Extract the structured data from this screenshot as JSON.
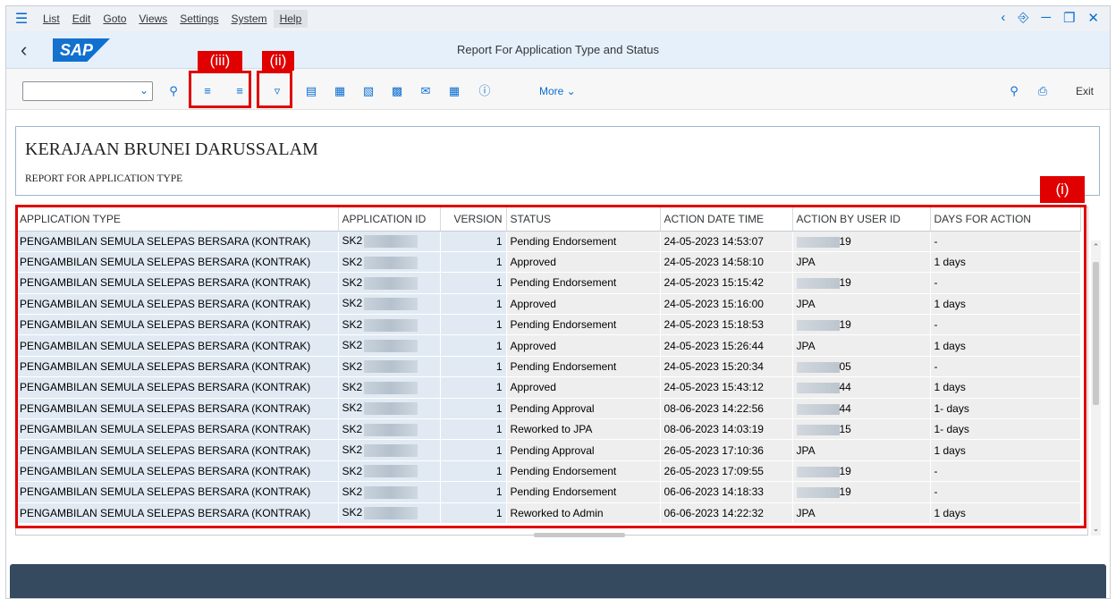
{
  "menu": {
    "items": [
      "List",
      "Edit",
      "Goto",
      "Views",
      "Settings",
      "System",
      "Help"
    ]
  },
  "window_controls": [
    "‹",
    "⎋",
    "—",
    "❐",
    "✕"
  ],
  "titlebar": {
    "logo": "SAP",
    "title": "Report For Application Type and Status"
  },
  "toolbar": {
    "combo_value": "",
    "more_label": "More",
    "exit_label": "Exit",
    "icons": [
      "dropdown-icon",
      "search-icon",
      "sort-ascending-icon",
      "sort-descending-icon",
      "filter-icon",
      "print-preview-icon",
      "excel-export-icon",
      "word-export-icon",
      "local-file-icon",
      "mail-icon",
      "grid-layout-icon",
      "info-icon",
      "find-icon",
      "print-icon"
    ]
  },
  "annotations": {
    "i": "(i)",
    "ii": "(ii)",
    "iii": "(iii)",
    "colors": {
      "box": "#e00000"
    }
  },
  "report": {
    "title": "KERAJAAN BRUNEI DARUSSALAM",
    "subtitle": "REPORT FOR APPLICATION TYPE"
  },
  "grid": {
    "columns": [
      "APPLICATION TYPE",
      "APPLICATION ID",
      "VERSION",
      "STATUS",
      "ACTION DATE TIME",
      "ACTION BY USER ID",
      "DAYS FOR ACTION"
    ],
    "rows": [
      [
        "PENGAMBILAN SEMULA SELEPAS BERSARA (KONTRAK)",
        "SK2",
        "1",
        "Pending Endorsement",
        "24-05-2023 14:53:07",
        "19",
        "-"
      ],
      [
        "PENGAMBILAN SEMULA SELEPAS BERSARA (KONTRAK)",
        "SK2",
        "1",
        "Approved",
        "24-05-2023 14:58:10",
        "JPA",
        "1 days"
      ],
      [
        "PENGAMBILAN SEMULA SELEPAS BERSARA (KONTRAK)",
        "SK2",
        "1",
        "Pending Endorsement",
        "24-05-2023 15:15:42",
        "19",
        "-"
      ],
      [
        "PENGAMBILAN SEMULA SELEPAS BERSARA (KONTRAK)",
        "SK2",
        "1",
        "Approved",
        "24-05-2023 15:16:00",
        "JPA",
        "1 days"
      ],
      [
        "PENGAMBILAN SEMULA SELEPAS BERSARA (KONTRAK)",
        "SK2",
        "1",
        "Pending Endorsement",
        "24-05-2023 15:18:53",
        "19",
        "-"
      ],
      [
        "PENGAMBILAN SEMULA SELEPAS BERSARA (KONTRAK)",
        "SK2",
        "1",
        "Approved",
        "24-05-2023 15:26:44",
        "JPA",
        "1 days"
      ],
      [
        "PENGAMBILAN SEMULA SELEPAS BERSARA (KONTRAK)",
        "SK2",
        "1",
        "Pending Endorsement",
        "24-05-2023 15:20:34",
        "05",
        "-"
      ],
      [
        "PENGAMBILAN SEMULA SELEPAS BERSARA (KONTRAK)",
        "SK2",
        "1",
        "Approved",
        "24-05-2023 15:43:12",
        "44",
        "1 days"
      ],
      [
        "PENGAMBILAN SEMULA SELEPAS BERSARA (KONTRAK)",
        "SK2",
        "1",
        "Pending Approval",
        "08-06-2023 14:22:56",
        "44",
        "1- days"
      ],
      [
        "PENGAMBILAN SEMULA SELEPAS BERSARA (KONTRAK)",
        "SK2",
        "1",
        "Reworked to JPA",
        "08-06-2023 14:03:19",
        "15",
        "1- days"
      ],
      [
        "PENGAMBILAN SEMULA SELEPAS BERSARA (KONTRAK)",
        "SK2",
        "1",
        "Pending Approval",
        "26-05-2023 17:10:36",
        "JPA",
        "1 days"
      ],
      [
        "PENGAMBILAN SEMULA SELEPAS BERSARA (KONTRAK)",
        "SK2",
        "1",
        "Pending Endorsement",
        "26-05-2023 17:09:55",
        "19",
        "-"
      ],
      [
        "PENGAMBILAN SEMULA SELEPAS BERSARA (KONTRAK)",
        "SK2",
        "1",
        "Pending Endorsement",
        "06-06-2023 14:18:33",
        "19",
        "-"
      ],
      [
        "PENGAMBILAN SEMULA SELEPAS BERSARA (KONTRAK)",
        "SK2",
        "1",
        "Reworked to Admin",
        "06-06-2023 14:22:32",
        "JPA",
        "1 days"
      ]
    ]
  },
  "colors": {
    "accent": "#0a6ed1",
    "titlebar_bg": "#e5f0fa",
    "footer_bg": "#354a5f"
  }
}
